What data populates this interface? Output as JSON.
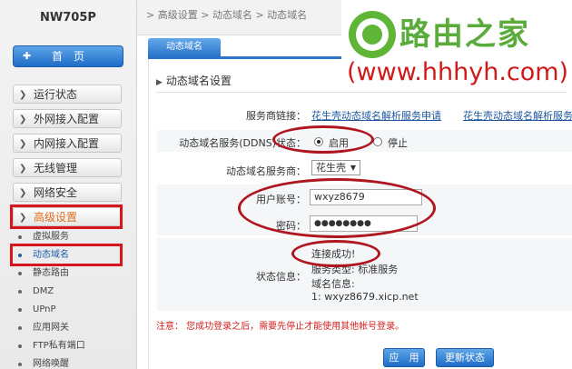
{
  "model": "NW705P",
  "nav": {
    "home": "首　页",
    "items": [
      "运行状态",
      "外网接入配置",
      "内网接入配置",
      "无线管理",
      "网络安全"
    ],
    "advanced": "高级设置",
    "sub_items": [
      "虚拟服务",
      "动态域名",
      "静态路由",
      "DMZ",
      "UPnP",
      "应用网关",
      "FTP私有端口",
      "网络唤醒"
    ]
  },
  "breadcrumb": {
    "items": [
      "高级设置",
      "动态域名",
      "动态域名"
    ],
    "separator": ">"
  },
  "tab": "动态域名",
  "section_title": "动态域名设置",
  "form": {
    "provider_link_label": "服务商链接：",
    "provider_links": [
      "花生壳动态域名解析服务申请",
      "花生壳动态域名解析服务"
    ],
    "ddns_label": "动态域名服务(DDNS)状态：",
    "enable_label": "启用",
    "disable_label": "停止",
    "ddns_status": "启用",
    "provider_label": "动态域名服务商：",
    "provider_value": "花生壳",
    "user_label": "用户账号：",
    "user_value": "wxyz8679",
    "password_label": "密码：",
    "password_value": "●●●●●●●●",
    "status_label": "状态信息：",
    "status_lines": [
      "连接成功!",
      "服务类型: 标准服务",
      "域名信息:",
      "1: wxyz8679.xicp.net"
    ]
  },
  "note": "注意：  您成功登录之后，需要先停止才能使用其他帐号登录。",
  "buttons": {
    "apply": "应　用",
    "refresh": "更新状态"
  },
  "watermark": {
    "name": "路由之家",
    "url": "(www.hhhyh.com)"
  },
  "colors": {
    "highlight_red": "#d8151c",
    "accent_blue": "#2b74c9",
    "watermark_green": "#59ac3a"
  }
}
